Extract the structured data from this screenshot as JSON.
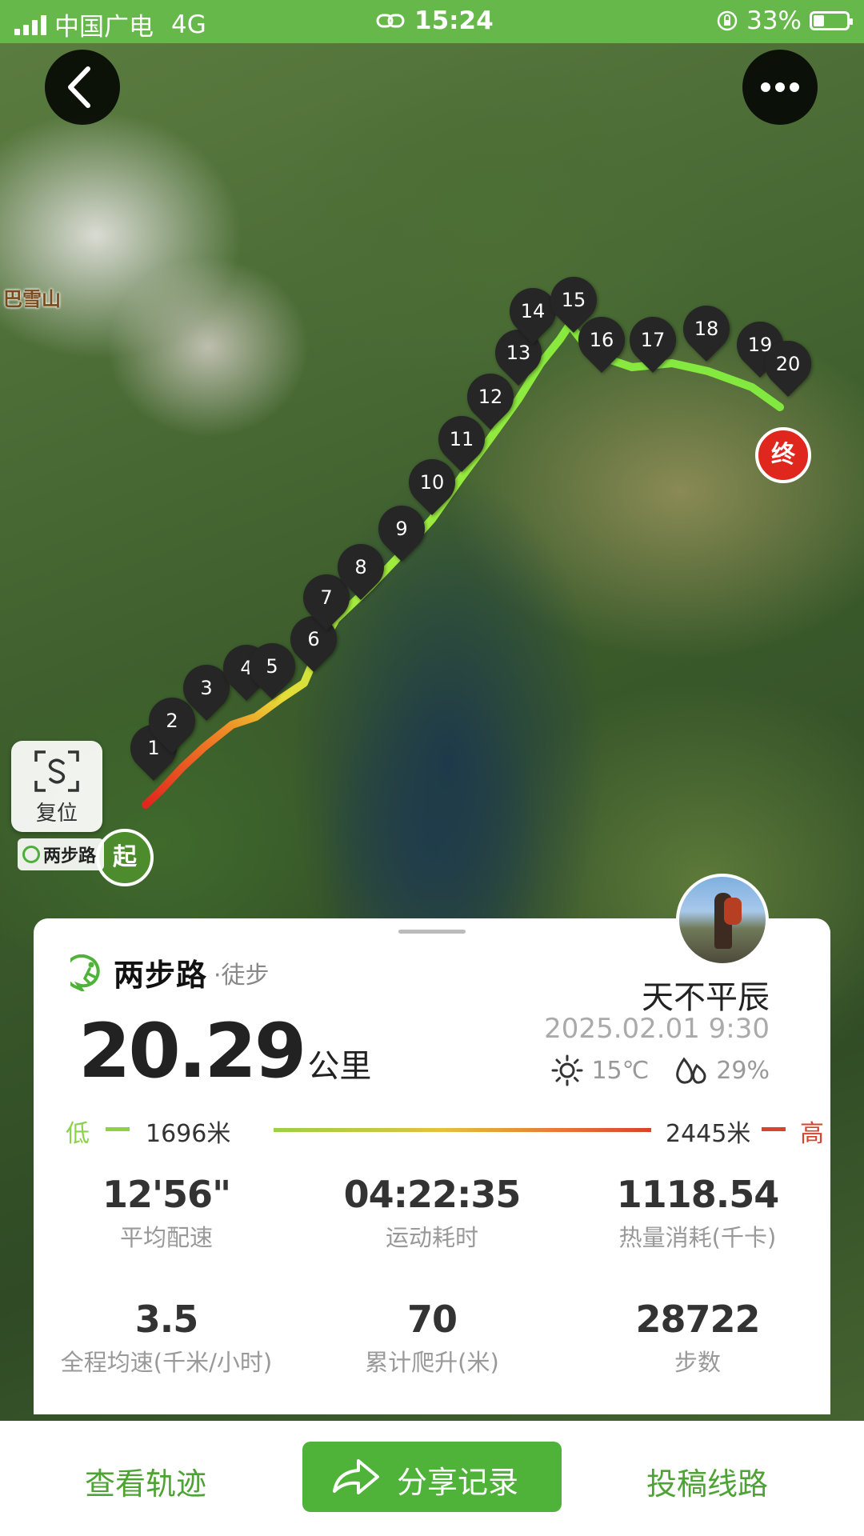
{
  "status_bar": {
    "carrier": "中国广电",
    "network": "4G",
    "time": "15:24",
    "battery": "33%",
    "battery_level": 0.33
  },
  "map": {
    "mountain_label": "巴雪山",
    "waypoints": [
      "1",
      "2",
      "3",
      "4",
      "5",
      "6",
      "7",
      "8",
      "9",
      "10",
      "11",
      "12",
      "13",
      "14",
      "15",
      "16",
      "17",
      "18",
      "19",
      "20"
    ],
    "start_label": "起",
    "end_label": "终",
    "reset_label": "复位",
    "logo_text": "两步路"
  },
  "card": {
    "brand_name": "两步路",
    "brand_sub": "·徒步",
    "username": "天不平辰",
    "distance_value": "20.29",
    "distance_unit": "公里",
    "datetime": "2025.02.01 9:30",
    "temperature": "15℃",
    "humidity": "29%",
    "elevation": {
      "low_label": "低",
      "low_value": "1696米",
      "high_value": "2445米",
      "high_label": "高"
    },
    "stats": [
      {
        "value": "12'56\"",
        "label": "平均配速"
      },
      {
        "value": "04:22:35",
        "label": "运动耗时"
      },
      {
        "value": "1118.54",
        "label": "热量消耗(千卡)"
      },
      {
        "value": "3.5",
        "label": "全程均速(千米/小时)"
      },
      {
        "value": "70",
        "label": "累计爬升(米)"
      },
      {
        "value": "28722",
        "label": "步数"
      }
    ]
  },
  "bottom_bar": {
    "view_track": "查看轨迹",
    "share": "分享记录",
    "submit_route": "投稿线路"
  },
  "colors": {
    "brand_green": "#4fb33a",
    "status_green": "#67b84b",
    "end_red": "#e0271e",
    "low_green": "#8bd24a",
    "high_red": "#d8432c"
  }
}
